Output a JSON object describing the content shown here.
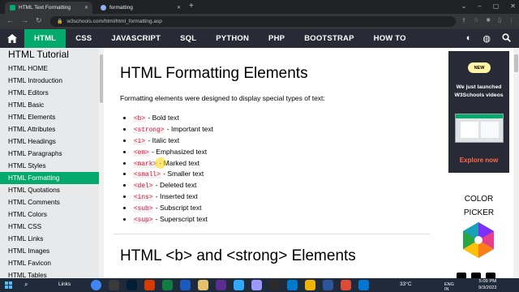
{
  "browser": {
    "tabs": [
      {
        "title": "HTML Text Formatting",
        "active": true
      },
      {
        "title": "formatting",
        "active": false
      }
    ],
    "url": "w3schools.com/html/html_formatting.asp"
  },
  "topnav": {
    "items": [
      "HTML",
      "CSS",
      "JAVASCRIPT",
      "SQL",
      "PYTHON",
      "PHP",
      "BOOTSTRAP",
      "HOW TO"
    ],
    "active": "HTML"
  },
  "sidebar": {
    "title": "HTML Tutorial",
    "items": [
      "HTML HOME",
      "HTML Introduction",
      "HTML Editors",
      "HTML Basic",
      "HTML Elements",
      "HTML Attributes",
      "HTML Headings",
      "HTML Paragraphs",
      "HTML Styles",
      "HTML Formatting",
      "HTML Quotations",
      "HTML Comments",
      "HTML Colors",
      "HTML CSS",
      "HTML Links",
      "HTML Images",
      "HTML Favicon",
      "HTML Tables"
    ],
    "active_index": 9
  },
  "main": {
    "heading": "HTML Formatting Elements",
    "intro": "Formatting elements were designed to display special types of text:",
    "list": [
      {
        "tag": "<b>",
        "desc": " - Bold text"
      },
      {
        "tag": "<strong>",
        "desc": " - Important text"
      },
      {
        "tag": "<i>",
        "desc": " - Italic text"
      },
      {
        "tag": "<em>",
        "desc": " - Emphasized text"
      },
      {
        "tag": "<mark>",
        "desc": " - Marked text"
      },
      {
        "tag": "<small>",
        "desc": " - Smaller text"
      },
      {
        "tag": "<del>",
        "desc": " - Deleted text"
      },
      {
        "tag": "<ins>",
        "desc": " - Inserted text"
      },
      {
        "tag": "<sub>",
        "desc": " - Subscript text"
      },
      {
        "tag": "<sup>",
        "desc": " - Superscript text"
      }
    ],
    "heading2": "HTML <b> and <strong> Elements"
  },
  "ad": {
    "badge": "NEW",
    "text": "We just launched W3Schools videos",
    "link": "Explore now"
  },
  "color_picker": {
    "line1": "COLOR",
    "line2": "PICKER"
  },
  "taskbar": {
    "links_label": "Links",
    "weather": "33°C",
    "lang": "ENG",
    "lang2": "IN",
    "time": "5:09 PM",
    "date": "9/3/2022"
  },
  "colors": {
    "w3_green": "#04aa6d",
    "topnav_bg": "#282a35",
    "code_red": "#dc143c",
    "ad_link": "#ff6a4d"
  },
  "icons": [
    "home-icon",
    "contrast-icon",
    "globe-icon",
    "search-icon",
    "lock-icon",
    "windows-start-icon"
  ]
}
